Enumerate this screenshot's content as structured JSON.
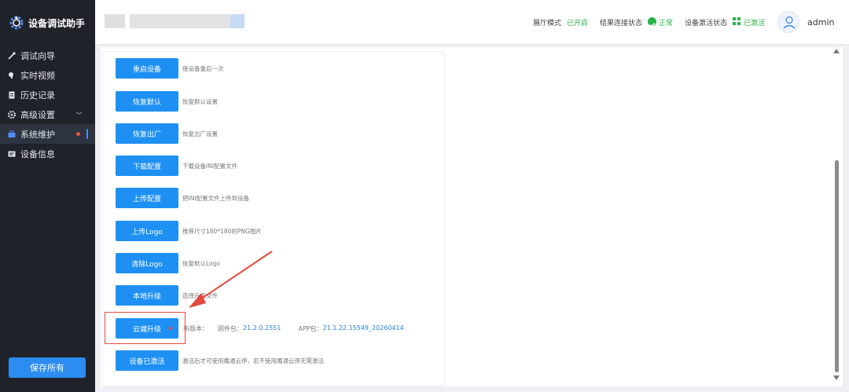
{
  "app": {
    "title": "设备调试助手"
  },
  "sidebar": {
    "items": [
      {
        "label": "调试向导"
      },
      {
        "label": "实时视频"
      },
      {
        "label": "历史记录"
      },
      {
        "label": "高级设置"
      },
      {
        "label": "系统维护"
      },
      {
        "label": "设备信息"
      }
    ],
    "save_all_label": "保存所有"
  },
  "header": {
    "showroom_label": "展厅模式",
    "showroom_value": "已开启",
    "connection_label": "结果连接状态",
    "connection_value": "正常",
    "activation_label": "设备激活状态",
    "activation_value": "已激活",
    "username": "admin"
  },
  "actions": [
    {
      "label": "重启设备",
      "desc": "使设备重启一次"
    },
    {
      "label": "恢复默认",
      "desc": "恢复默认设置"
    },
    {
      "label": "恢复出厂",
      "desc": "恢复出厂设置"
    },
    {
      "label": "下载配置",
      "desc": "下载设备INI配置文件"
    },
    {
      "label": "上传配置",
      "desc": "把INI配置文件上传到设备"
    },
    {
      "label": "上传Logo",
      "desc": "推荐尺寸180*180的PNG图片"
    },
    {
      "label": "清除Logo",
      "desc": "恢复默认Logo"
    },
    {
      "label": "本地升级",
      "desc": "选择升级文件"
    },
    {
      "label": "云端升级"
    },
    {
      "label": "设备已激活",
      "desc": "激活后才可使用鹰通云停，若不使用鹰通云停无需激活"
    }
  ],
  "cloud_upgrade": {
    "new_version_label": "新版本：",
    "firmware_label": "固件包：",
    "firmware_value": "21.2.0.2551",
    "app_label": "APP包：",
    "app_value": "21.1.22.15549_20260414"
  },
  "colors": {
    "primary": "#1e90f3",
    "sidebar_bg": "#1f2329",
    "success": "#28b446",
    "annotation": "#e2483d"
  }
}
